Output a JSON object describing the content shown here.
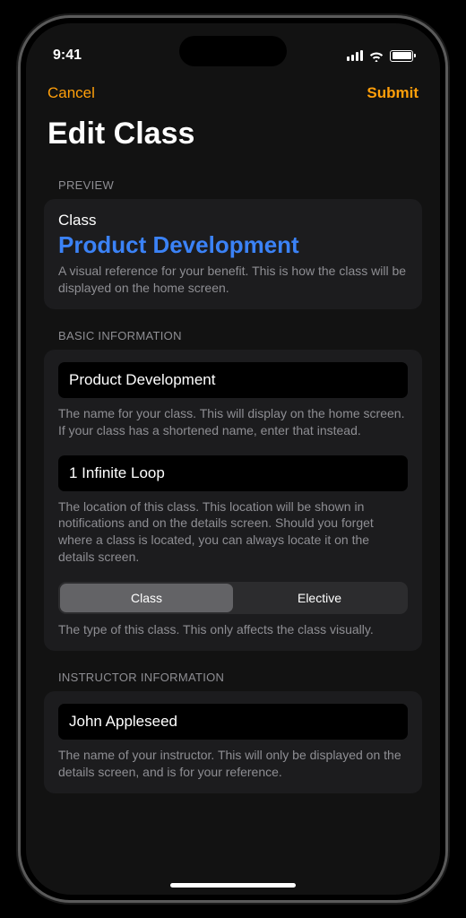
{
  "status": {
    "time": "9:41"
  },
  "nav": {
    "cancel": "Cancel",
    "submit": "Submit"
  },
  "title": "Edit Class",
  "preview": {
    "header": "PREVIEW",
    "label": "Class",
    "name": "Product Development",
    "helper": "A visual reference for your benefit. This is how the class will be displayed on the home screen."
  },
  "basic": {
    "header": "BASIC INFORMATION",
    "name_value": "Product Development",
    "name_helper": "The name for your class. This will display on the home screen. If your class has a shortened name, enter that instead.",
    "location_value": "1 Infinite Loop",
    "location_helper": "The location of this class. This location will be shown in notifications and on the details screen. Should you forget where a class is located, you can always locate it on the details screen.",
    "segments": {
      "class": "Class",
      "elective": "Elective"
    },
    "type_helper": "The type of this class. This only affects the class visually."
  },
  "instructor": {
    "header": "INSTRUCTOR INFORMATION",
    "name_value": "John Appleseed",
    "name_helper": "The name of your instructor. This will only be displayed on the details screen, and is for your reference."
  }
}
